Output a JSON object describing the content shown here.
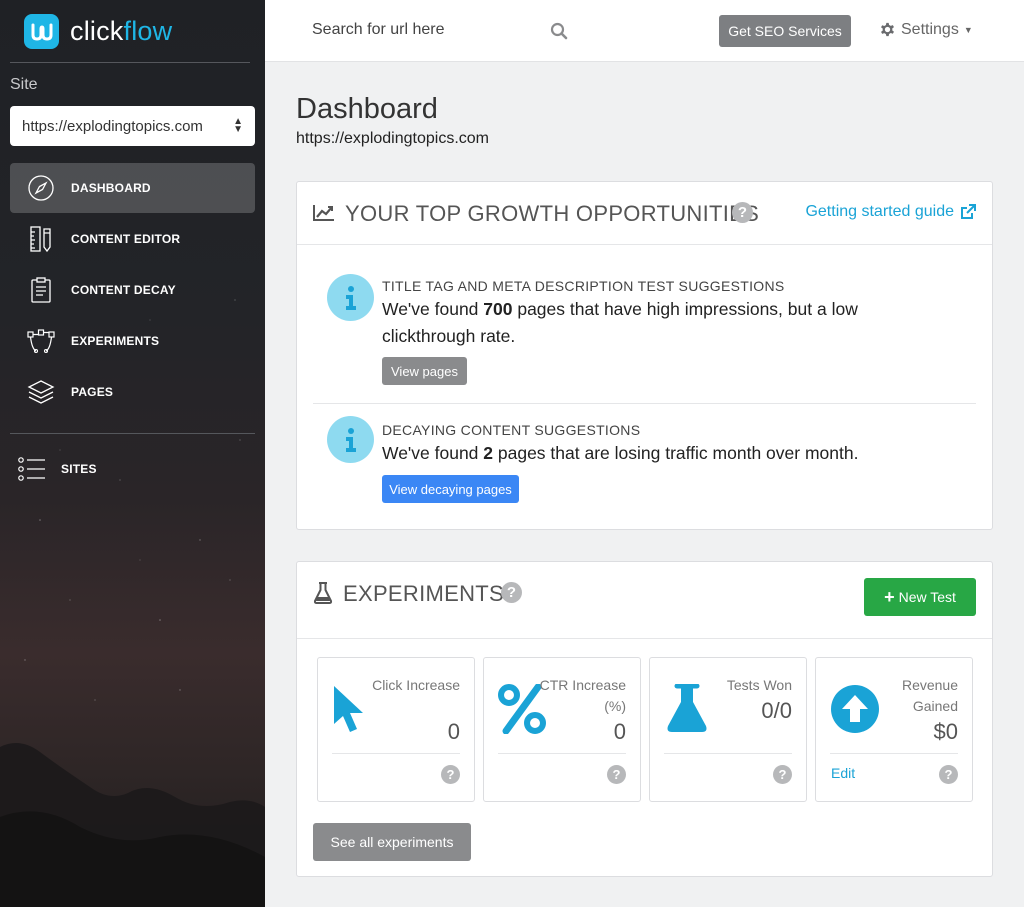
{
  "brand": {
    "name_plain": "click",
    "name_accent": "flow"
  },
  "sidebar": {
    "site_label": "Site",
    "site_select": "https://explodingtopics.com",
    "items": [
      {
        "label": "DASHBOARD",
        "icon": "compass-icon",
        "active": true
      },
      {
        "label": "CONTENT EDITOR",
        "icon": "ruler-pencil-icon"
      },
      {
        "label": "CONTENT DECAY",
        "icon": "clipboard-icon"
      },
      {
        "label": "EXPERIMENTS",
        "icon": "vector-path-icon"
      },
      {
        "label": "PAGES",
        "icon": "layers-icon"
      }
    ],
    "sites_label": "SITES"
  },
  "topbar": {
    "search_placeholder": "Search for url here",
    "seo_button": "Get SEO Services",
    "settings_label": "Settings"
  },
  "page": {
    "title": "Dashboard",
    "subtitle": "https://explodingtopics.com"
  },
  "growth": {
    "title": "YOUR TOP GROWTH OPPORTUNITIES",
    "guide_link": "Getting started guide",
    "opportunities": [
      {
        "title": "TITLE TAG AND META DESCRIPTION TEST SUGGESTIONS",
        "text_pre": "We've found ",
        "count": "700",
        "text_post": " pages that have high impressions, but a low clickthrough rate.",
        "button": "View pages"
      },
      {
        "title": "DECAYING CONTENT SUGGESTIONS",
        "text_pre": "We've found ",
        "count": "2",
        "text_post": " pages that are losing traffic month over month.",
        "button": "View decaying pages"
      }
    ]
  },
  "experiments": {
    "title": "EXPERIMENTS",
    "new_test": "New Test",
    "stats": [
      {
        "label": "Click Increase",
        "value": "0",
        "icon": "cursor-icon"
      },
      {
        "label": "CTR Increase (%)",
        "value": "0",
        "icon": "percent-icon"
      },
      {
        "label": "Tests Won",
        "value": "0/0",
        "icon": "flask-icon"
      },
      {
        "label": "Revenue Gained",
        "value": "$0",
        "icon": "arrow-up-circle-icon",
        "edit": "Edit"
      }
    ],
    "see_all": "See all experiments"
  },
  "colors": {
    "accent": "#1fb6e6",
    "link": "#1aa3d6",
    "primary_button": "#3b87f5",
    "success_button": "#28a745"
  }
}
